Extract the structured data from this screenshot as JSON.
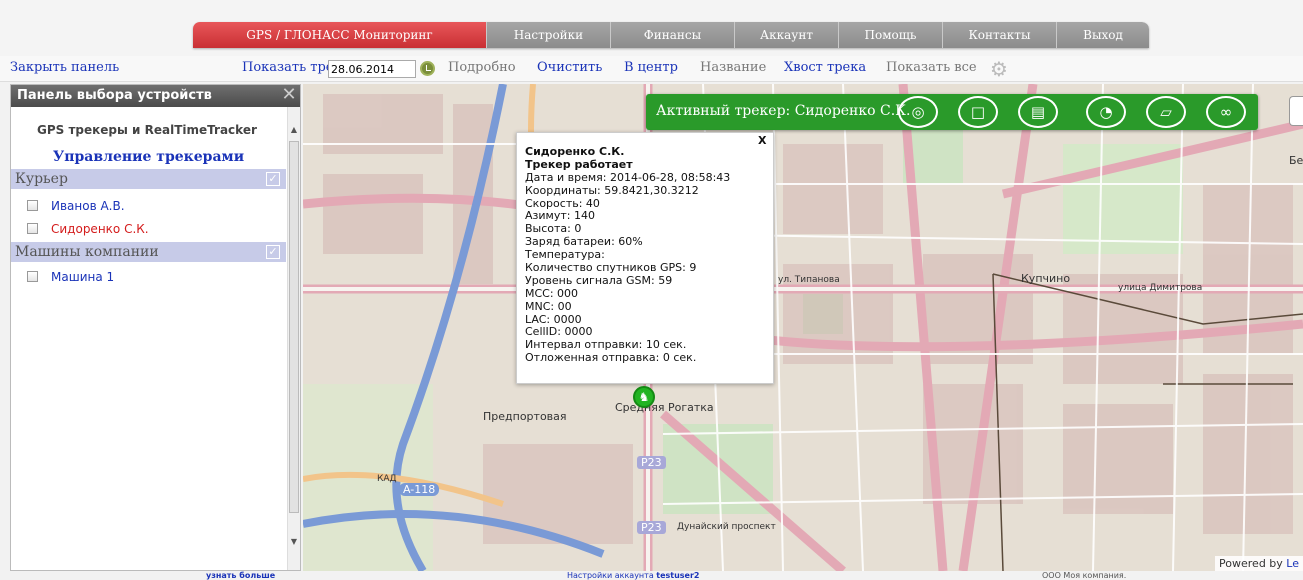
{
  "nav": {
    "tabs": [
      {
        "label": "GPS / ГЛОНАСС Мониторинг",
        "active": true
      },
      {
        "label": "Настройки"
      },
      {
        "label": "Финансы"
      },
      {
        "label": "Аккаунт"
      },
      {
        "label": "Помощь"
      },
      {
        "label": "Контакты"
      },
      {
        "label": "Выход"
      }
    ]
  },
  "toolbar": {
    "close_panel": "Закрыть панель",
    "show_track": "Показать трек за",
    "date_value": "28.06.2014",
    "details": "Подробно",
    "clear": "Очистить",
    "center": "В центр",
    "name": "Название",
    "track_tail": "Хвост трека",
    "show_all": "Показать все"
  },
  "panel": {
    "header": "Панель выбора устройств",
    "title": "GPS трекеры и RealTimeTracker",
    "subtitle": "Управление трекерами",
    "groups": [
      {
        "name": "Курьер",
        "checked": true,
        "devices": [
          {
            "name": "Иванов А.В.",
            "checked": false,
            "highlight": false
          },
          {
            "name": "Сидоренко С.К.",
            "checked": false,
            "highlight": true
          }
        ]
      },
      {
        "name": "Машины компании",
        "checked": true,
        "devices": [
          {
            "name": "Машина 1",
            "checked": false,
            "highlight": false
          }
        ]
      }
    ]
  },
  "map": {
    "active_tracker": "Активный трекер: Сидоренко С.К.",
    "popup": {
      "close": "X",
      "name": "Сидоренко С.К.",
      "status": "Трекер работает",
      "lines": [
        "Дата и время: 2014-06-28, 08:58:43",
        "Координаты: 59.8421,30.3212",
        "Скорость: 40",
        "Азимут: 140",
        "Высота: 0",
        "Заряд батареи: 60%",
        "Температура:",
        "Количество спутников GPS: 9",
        "Уровень сигнала GSM: 59",
        "MCC: 000",
        "MNC: 00",
        "LAC: 0000",
        "CellID: 0000",
        "Интервал отправки: 10 сек.",
        "Отложенная отправка: 0 сек."
      ]
    },
    "labels": {
      "kupchino": "Купчино",
      "predportovaya": "Предпортовая",
      "srednyaya_rogatka": "Средняя Рогатка",
      "r23": "P23",
      "r23b": "P23",
      "a118": "A-118",
      "kad": "КАД",
      "ul_dimitrova": "улица Димитрова",
      "ul_tipanova": "ул. Типанова",
      "dunaysky": "Дунайский проспект",
      "be": "Бе"
    },
    "powered_by": "Powered by",
    "powered_link": "Le"
  },
  "footer": {
    "learn_more": "узнать больше",
    "account_settings": "Настройки аккаунта",
    "user": "testuser2",
    "company": "ООО Моя компания."
  },
  "colors": {
    "accent_red": "#d63a3e",
    "tracker_green": "#2a9a2a",
    "link_blue": "#1a33b8",
    "group_bg": "#c7cbe8"
  }
}
